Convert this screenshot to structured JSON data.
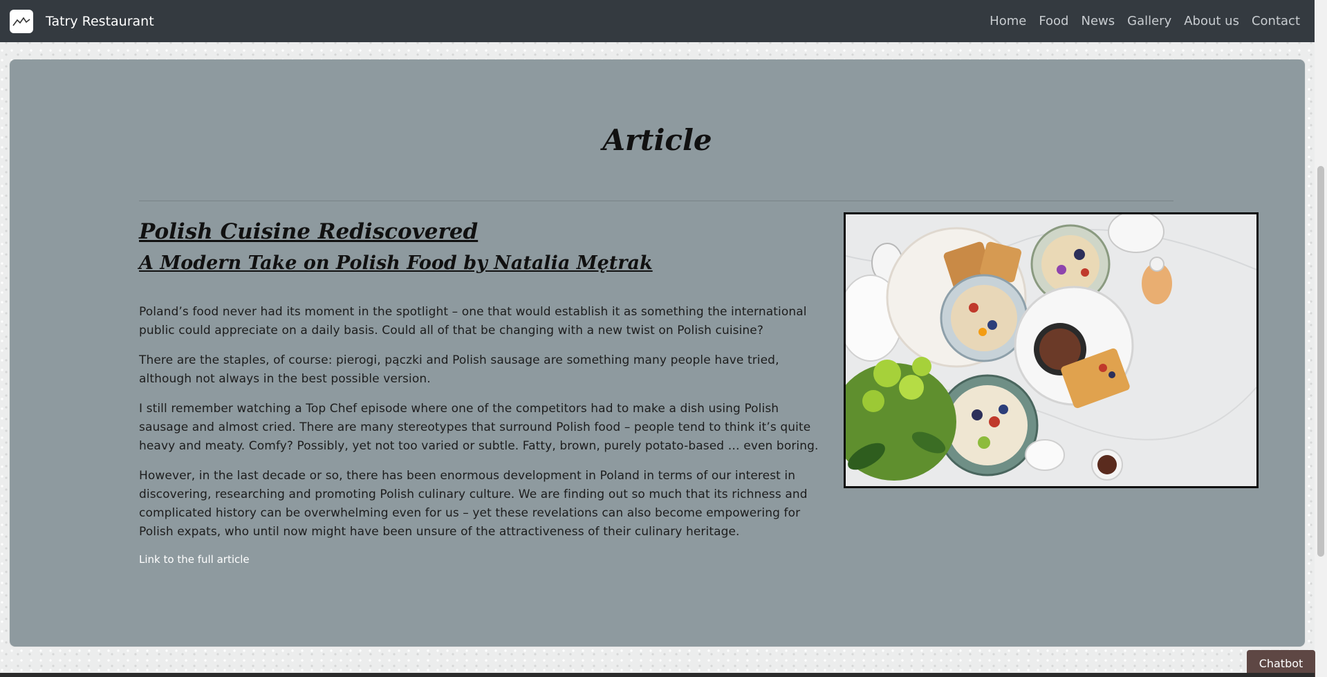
{
  "navbar": {
    "brand": "Tatry Restaurant",
    "logo_icon": "mountain-icon",
    "links": [
      "Home",
      "Food",
      "News",
      "Gallery",
      "About us",
      "Contact"
    ]
  },
  "section": {
    "title": "Article"
  },
  "article": {
    "headline": "Polish Cuisine Rediscovered",
    "subheadline": "A Modern Take on Polish Food by Natalia Mętrak",
    "paragraphs": [
      "Poland’s food never had its moment in the spotlight – one that would establish it as something the international public could appreciate on a daily basis. Could all of that be changing with a new twist on Polish cuisine?",
      "There are the staples, of course: pierogi, pączki and Polish sausage are something many people have tried, although not always in the best possible version.",
      "I still remember watching a Top Chef episode where one of the competitors had to make a dish using Polish sausage and almost cried. There are many stereotypes that surround Polish food – people tend to think it’s quite heavy and meaty. Comfy? Possibly, yet not too varied or subtle. Fatty, brown, purely potato-based … even boring.",
      "However, in the last decade or so, there has been enormous development in Poland in terms of our interest in discovering, researching and promoting Polish culinary culture. We are finding out so much that its richness and complicated history can be overwhelming even for us – yet these revelations can also become empowering for Polish expats, who until now might have been unsure of the attractiveness of their culinary heritage."
    ],
    "link_text": "Link to the full article"
  },
  "chatbot": {
    "label": "Chatbot"
  },
  "colors": {
    "navbar_bg": "#343a40",
    "card_bg": "#8e9a9f",
    "chatbot_bg": "#5e4744"
  }
}
